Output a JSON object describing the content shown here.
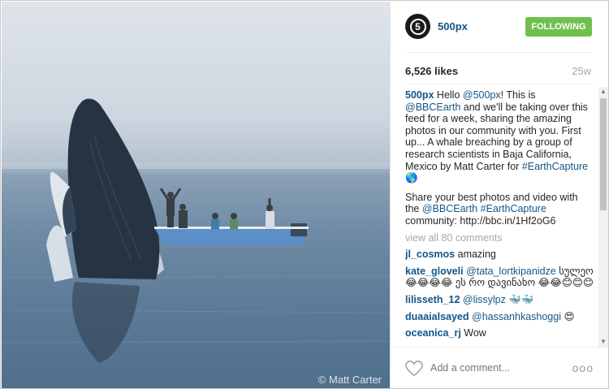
{
  "photo": {
    "credit": "© Matt Carter"
  },
  "header": {
    "username": "500px",
    "follow_label": "FOLLOWING",
    "avatar_glyph": "5"
  },
  "stats": {
    "likes": "6,526 likes",
    "time_ago": "25w"
  },
  "caption": {
    "user": "500px",
    "p1_a": " Hello ",
    "mention1": "@500px",
    "p1_b": "! This is ",
    "mention2": "@BBCEarth",
    "p1_c": " and we'll be taking over this feed for a week, sharing the amazing photos in our community with you. First up... A whale breaching by a group of research scientists in Baja California, Mexico by Matt Carter for ",
    "hashtag1": "#EarthCapture",
    "p1_d": " 🌎",
    "p2_a": "Share your best photos and video with the ",
    "mention3": "@BBCEarth",
    "hashtag2": "#EarthCapture",
    "p2_b": " community: http://bbc.in/1Hf2oG6"
  },
  "view_all": "view all 80 comments",
  "comments": [
    {
      "user": "jl_cosmos",
      "mention": "",
      "text": " amazing"
    },
    {
      "user": "kate_gloveli",
      "mention": "@tata_lortkipanidze",
      "text": " სულეო 😂😂😂😂 ეს რო დავინახო 😂😂😊😊😊"
    },
    {
      "user": "lilisseth_12",
      "mention": "@lissylpz",
      "text": " 🐳🐳"
    },
    {
      "user": "duaaialsayed",
      "mention": "@hassanhkashoggi",
      "text": " 😍"
    },
    {
      "user": "oceanica_rj",
      "mention": "",
      "text": " Wow"
    }
  ],
  "footer": {
    "add_comment_placeholder": "Add a comment...",
    "more_glyph": "ooo"
  },
  "colors": {
    "link": "#125688",
    "follow_bg": "#70c050",
    "muted": "#a5a7aa"
  },
  "icons": {
    "like": "heart-icon",
    "more": "more-options-icon"
  }
}
